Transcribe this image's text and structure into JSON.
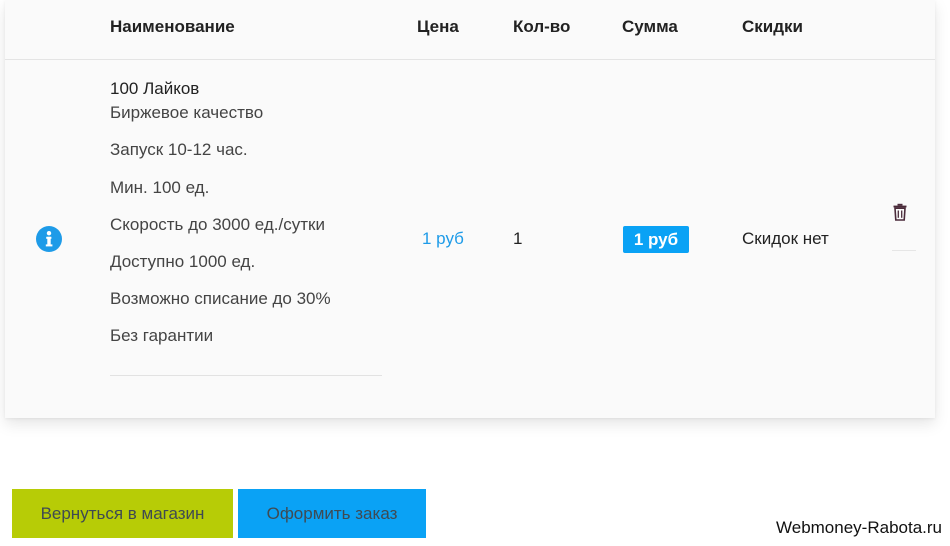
{
  "table": {
    "headers": {
      "name": "Наименование",
      "price": "Цена",
      "quantity": "Кол-во",
      "sum": "Сумма",
      "discounts": "Скидки"
    },
    "row": {
      "title": "100 Лайков",
      "features": [
        "Биржевое качество",
        "Запуск 10-12 час.",
        "Мин. 100 ед.",
        "Скорость до 3000 ед./сутки",
        "Доступно 1000 ед.",
        "Возможно списание до 30%",
        "Без гарантии"
      ],
      "price": "1 руб",
      "quantity": "1",
      "sum": "1 руб",
      "discount": "Скидок нет",
      "icons": {
        "info": "info-circle-icon",
        "delete": "trash-icon"
      }
    }
  },
  "buttons": {
    "back": "Вернуться в магазин",
    "order": "Оформить заказ"
  },
  "watermark": "Webmoney-Rabota.ru",
  "colors": {
    "accent_blue": "#0aa2f5",
    "price_blue": "#1e9be8",
    "back_button_green": "#b7cc06",
    "delete_icon": "#4a2b3a"
  }
}
